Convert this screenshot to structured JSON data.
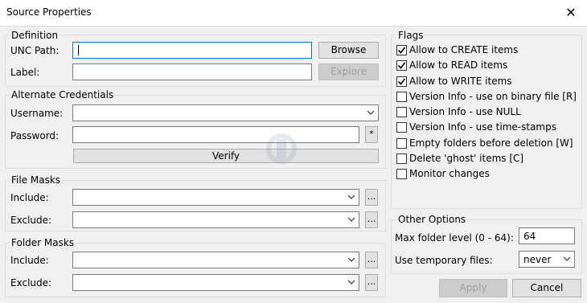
{
  "window": {
    "title": "Source Properties",
    "close_glyph": "✕"
  },
  "definition": {
    "legend": "Definition",
    "unc_label": "UNC Path:",
    "unc_value": "",
    "label_label": "Label:",
    "label_value": "",
    "browse": "Browse",
    "explore": "Explore"
  },
  "credentials": {
    "legend": "Alternate Credentials",
    "username_label": "Username:",
    "password_label": "Password:",
    "asterisk": "*",
    "verify": "Verify"
  },
  "file_masks": {
    "legend": "File Masks",
    "include_label": "Include:",
    "exclude_label": "Exclude:",
    "more": "..."
  },
  "folder_masks": {
    "legend": "Folder Masks",
    "include_label": "Include:",
    "exclude_label": "Exclude:",
    "more": "..."
  },
  "flags": {
    "legend": "Flags",
    "items": [
      {
        "label": "Allow to CREATE items",
        "checked": true
      },
      {
        "label": "Allow to READ items",
        "checked": true
      },
      {
        "label": "Allow to WRITE items",
        "checked": true
      },
      {
        "label": "Version Info - use on binary file [R]",
        "checked": false
      },
      {
        "label": "Version Info - use NULL",
        "checked": false
      },
      {
        "label": "Version Info - use time-stamps",
        "checked": false
      },
      {
        "label": "Empty folders before deletion [W]",
        "checked": false
      },
      {
        "label": "Delete 'ghost' items [C]",
        "checked": false
      },
      {
        "label": "Monitor changes",
        "checked": false
      }
    ]
  },
  "other_options": {
    "legend": "Other Options",
    "max_folder_label": "Max folder level (0 - 64):",
    "max_folder_value": "64",
    "temp_files_label": "Use temporary files:",
    "temp_files_value": "never"
  },
  "footer": {
    "apply": "Apply",
    "cancel": "Cancel"
  },
  "colors": {
    "accent": "#0078d7",
    "background": "#f0f0f0"
  }
}
